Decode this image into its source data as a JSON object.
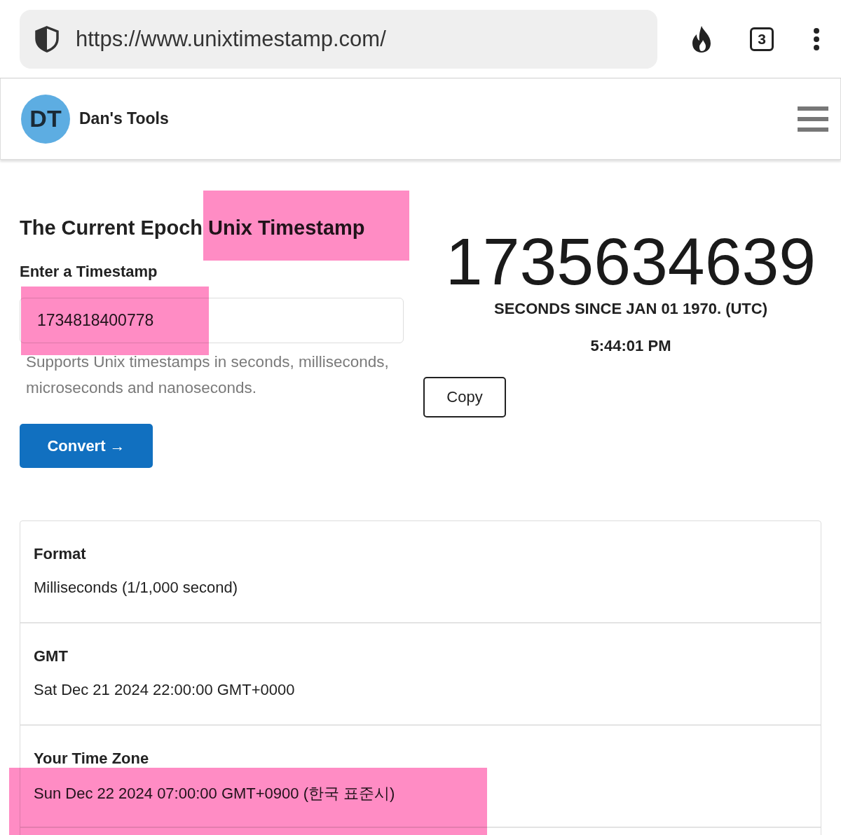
{
  "browser": {
    "url": "https://www.unixtimestamp.com/",
    "tab_count": "3"
  },
  "site_header": {
    "logo": "DT",
    "name": "Dan's Tools"
  },
  "converter": {
    "heading": [
      {
        "text": "The Current Epoch",
        "highlighted": false
      },
      {
        "text": "Unix Timestamp",
        "highlighted": true
      }
    ],
    "input_label": "Enter a Timestamp",
    "input": {
      "value": "1734818400778",
      "highlighted": true
    },
    "help": "Supports Unix timestamps in seconds, milliseconds, microseconds and nanoseconds.",
    "button": "Convert →"
  },
  "current": {
    "timestamp": "1735634639",
    "caption": "SECONDS SINCE JAN 01 1970. (UTC)",
    "time": "5:44:01 PM",
    "button": "Copy"
  },
  "results": [
    {
      "label": "Format",
      "value": "Milliseconds (1/1,000 second)",
      "highlighted": false
    },
    {
      "label": "GMT",
      "value": "Sat Dec 21 2024 22:00:00 GMT+0000",
      "highlighted": false
    },
    {
      "label": "Your Time Zone",
      "value": "Sun Dec 22 2024 07:00:00 GMT+0900 (한국 표준시)",
      "highlighted": true
    }
  ]
}
